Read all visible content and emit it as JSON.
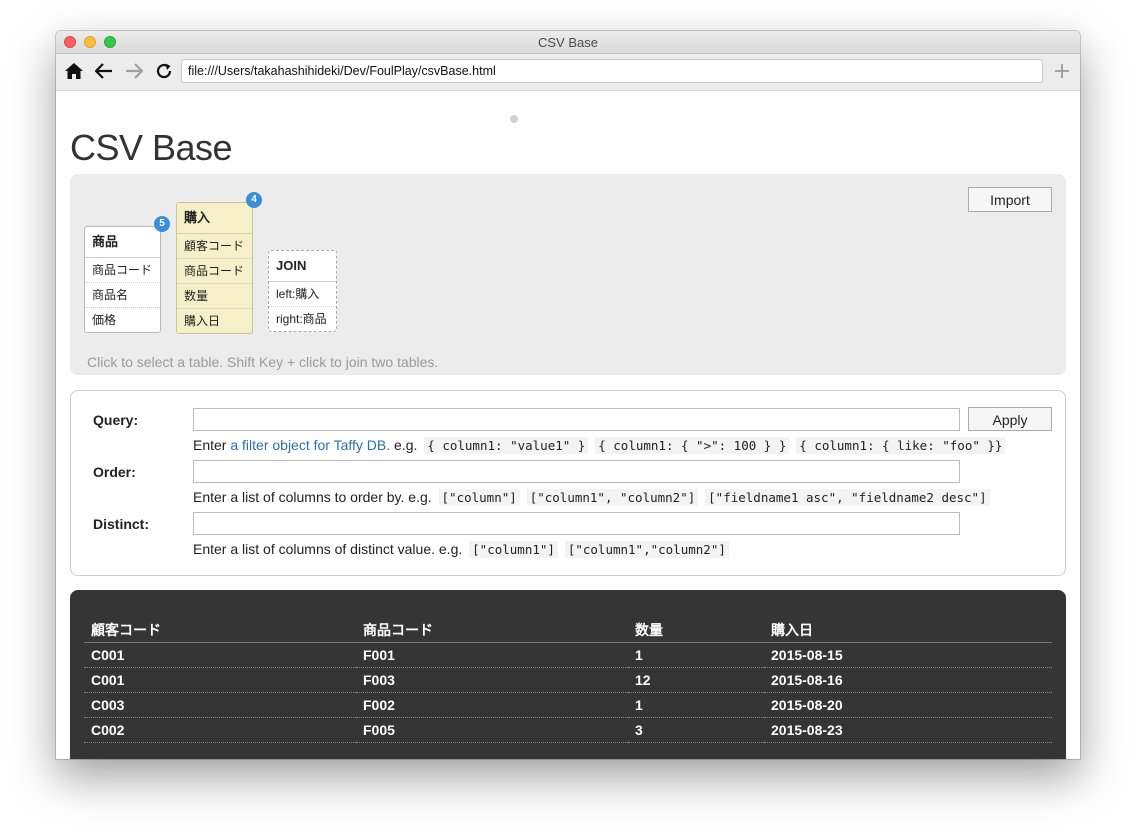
{
  "window": {
    "title": "CSV Base",
    "url": "file:///Users/takahashihideki/Dev/FoulPlay/csvBase.html"
  },
  "page": {
    "title": "CSV Base"
  },
  "panel": {
    "import_label": "Import",
    "hint": "Click to select a table. Shift Key + click to join two tables.",
    "tables": [
      {
        "name": "商品",
        "badge": "5",
        "columns": [
          "商品コード",
          "商品名",
          "価格"
        ]
      },
      {
        "name": "購入",
        "badge": "4",
        "columns": [
          "顧客コード",
          "商品コード",
          "数量",
          "購入日"
        ]
      }
    ],
    "join": {
      "name": "JOIN",
      "left": "left:購入",
      "right": "right:商品"
    }
  },
  "query": {
    "query_label": "Query:",
    "order_label": "Order:",
    "distinct_label": "Distinct:",
    "apply_label": "Apply",
    "query_help_prefix": "Enter",
    "query_help_link": "a filter object for Taffy DB.",
    "query_help_eg": "e.g.",
    "query_examples": [
      "{ column1: \"value1\" }",
      "{ column1: { \">\": 100 } }",
      "{ column1: { like: \"foo\" }}"
    ],
    "order_help": "Enter a list of columns to order by. e.g.",
    "order_examples": [
      "[\"column\"]",
      "[\"column1\", \"column2\"]",
      "[\"fieldname1 asc\", \"fieldname2 desc\"]"
    ],
    "distinct_help": "Enter a list of columns of distinct value. e.g.",
    "distinct_examples": [
      "[\"column1\"]",
      "[\"column1\",\"column2\"]"
    ]
  },
  "results": {
    "headers": [
      "顧客コード",
      "商品コード",
      "数量",
      "購入日"
    ],
    "rows": [
      [
        "C001",
        "F001",
        "1",
        "2015-08-15"
      ],
      [
        "C001",
        "F003",
        "12",
        "2015-08-16"
      ],
      [
        "C003",
        "F002",
        "1",
        "2015-08-20"
      ],
      [
        "C002",
        "F005",
        "3",
        "2015-08-23"
      ]
    ]
  }
}
